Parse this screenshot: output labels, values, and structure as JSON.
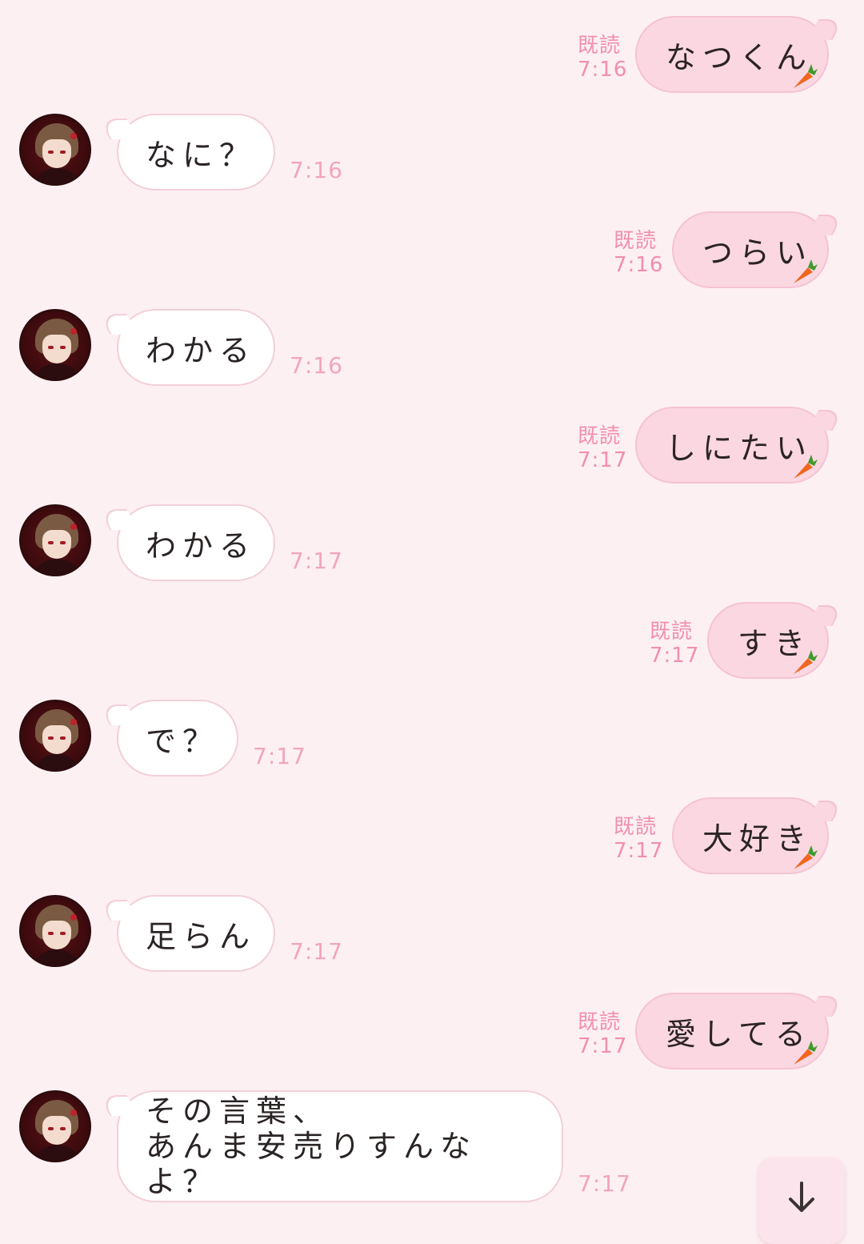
{
  "messages": [
    {
      "side": "out",
      "text": "なつくん",
      "read": "既読",
      "time": "7:16"
    },
    {
      "side": "in",
      "text": "なに？",
      "time": "7:16"
    },
    {
      "side": "out",
      "text": "つらい",
      "read": "既読",
      "time": "7:16"
    },
    {
      "side": "in",
      "text": "わかる",
      "time": "7:16"
    },
    {
      "side": "out",
      "text": "しにたい",
      "read": "既読",
      "time": "7:17"
    },
    {
      "side": "in",
      "text": "わかる",
      "time": "7:17"
    },
    {
      "side": "out",
      "text": "すき",
      "read": "既読",
      "time": "7:17"
    },
    {
      "side": "in",
      "text": "で？",
      "time": "7:17"
    },
    {
      "side": "out",
      "text": "大好き",
      "read": "既読",
      "time": "7:17"
    },
    {
      "side": "in",
      "text": "足らん",
      "time": "7:17"
    },
    {
      "side": "out",
      "text": "愛してる",
      "read": "既読",
      "time": "7:17"
    },
    {
      "side": "in",
      "lines": [
        "その言葉、",
        "あんま安売りすんなよ？"
      ],
      "time": "7:17"
    }
  ],
  "icons": {
    "carrot": "carrot-icon",
    "scroll": "arrow-down-icon",
    "avatar": "contact-avatar"
  },
  "colors": {
    "background": "#fdf0f3",
    "incoming_bubble": "#ffffff",
    "outgoing_bubble": "#fbd7e2",
    "timestamp": "#f1a5bd",
    "read_label": "#f28fae",
    "carrot": "#f0671f"
  }
}
